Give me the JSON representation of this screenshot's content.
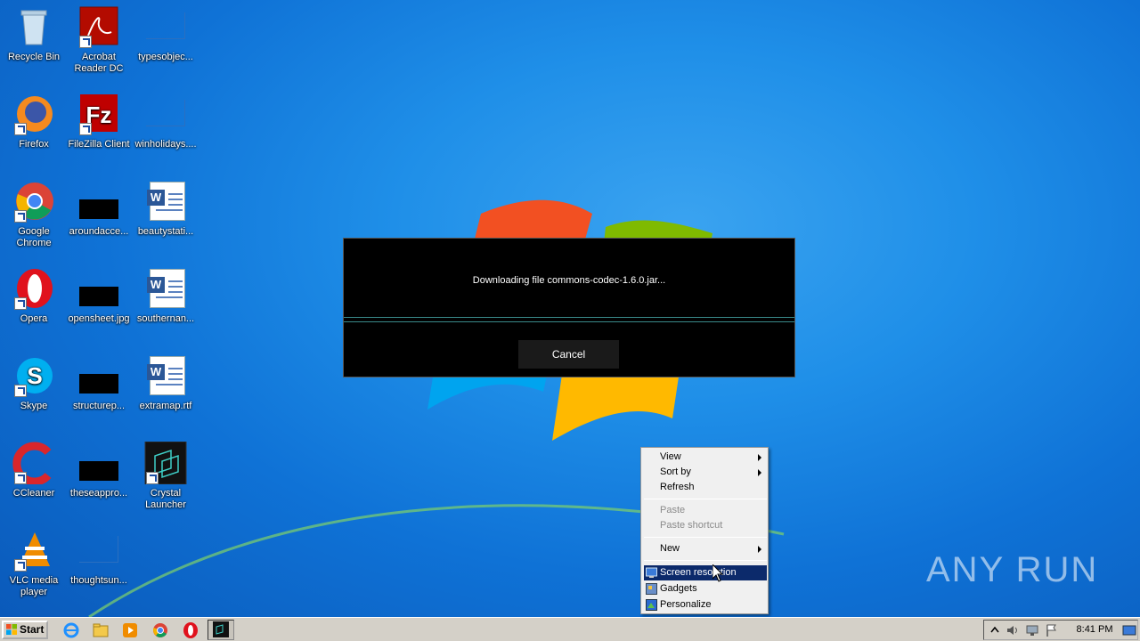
{
  "desktop": {
    "icons": [
      {
        "label": "Recycle Bin"
      },
      {
        "label": "Acrobat Reader DC"
      },
      {
        "label": "typesobjec..."
      },
      {
        "label": "Firefox"
      },
      {
        "label": "FileZilla Client"
      },
      {
        "label": "winholidays...."
      },
      {
        "label": "Google Chrome"
      },
      {
        "label": "aroundacce..."
      },
      {
        "label": "beautystati..."
      },
      {
        "label": "Opera"
      },
      {
        "label": "opensheet.jpg"
      },
      {
        "label": "southernan..."
      },
      {
        "label": "Skype"
      },
      {
        "label": "structurep..."
      },
      {
        "label": "extramap.rtf"
      },
      {
        "label": "CCleaner"
      },
      {
        "label": "theseappro..."
      },
      {
        "label": "Crystal Launcher"
      },
      {
        "label": "VLC media player"
      },
      {
        "label": "thoughtsun..."
      }
    ]
  },
  "dialog": {
    "message": "Downloading file commons-codec-1.6.0.jar...",
    "cancel_label": "Cancel"
  },
  "context_menu": {
    "items": [
      {
        "label": "View"
      },
      {
        "label": "Sort by"
      },
      {
        "label": "Refresh"
      },
      {
        "label": "Paste"
      },
      {
        "label": "Paste shortcut"
      },
      {
        "label": "New"
      },
      {
        "label": "Screen resolution"
      },
      {
        "label": "Gadgets"
      },
      {
        "label": "Personalize"
      }
    ]
  },
  "watermark": "ANY RUN",
  "taskbar": {
    "start_label": "Start",
    "clock": "8:41 PM"
  },
  "colors": {
    "menu_highlight": "#0c2a6b",
    "dialog_bg": "#000000",
    "desktop_blue": "#1f8fe8"
  }
}
